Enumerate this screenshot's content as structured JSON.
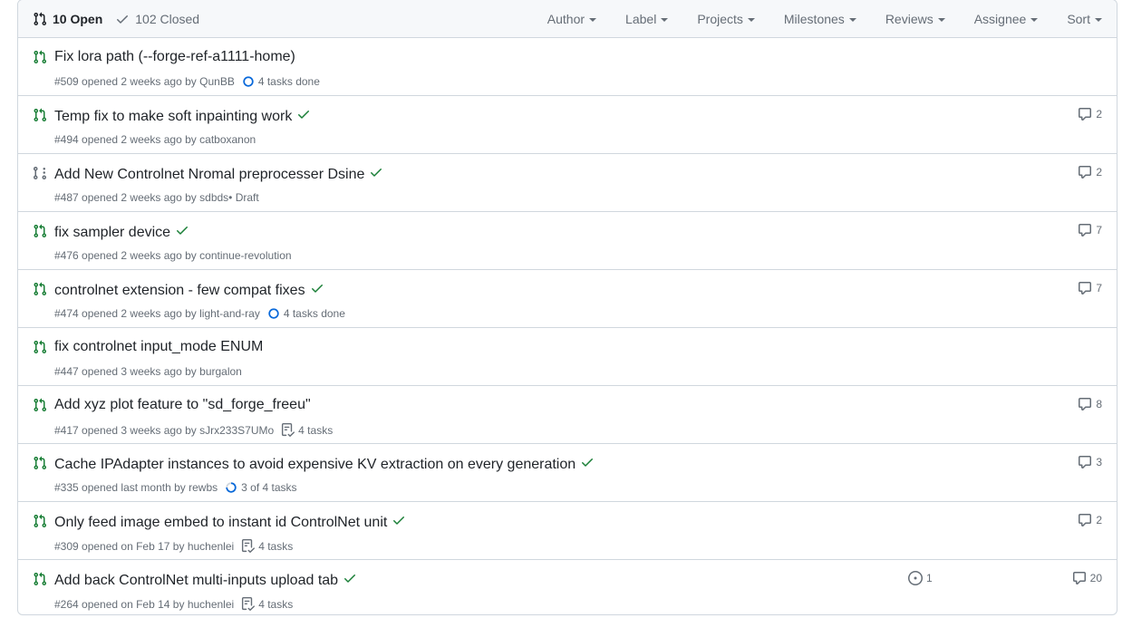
{
  "header": {
    "open_label": "10 Open",
    "closed_label": "102 Closed",
    "filters": [
      "Author",
      "Label",
      "Projects",
      "Milestones",
      "Reviews",
      "Assignee",
      "Sort"
    ]
  },
  "colors": {
    "open_green": "#1a7f37",
    "draft_gray": "#656d76",
    "task_blue": "#0969da",
    "border": "#d0d7de"
  },
  "pulls": [
    {
      "title": "Fix lora path (--forge-ref-a1111-home)",
      "meta": "#509 opened 2 weeks ago by",
      "author": "QunBB",
      "suffix": "",
      "status_check": false,
      "draft": false,
      "tasks": "4 tasks done",
      "tasks_icon": "circle",
      "comments": "",
      "linked": ""
    },
    {
      "title": "Temp fix to make soft inpainting work",
      "meta": "#494 opened 2 weeks ago by",
      "author": "catboxanon",
      "suffix": "",
      "status_check": true,
      "draft": false,
      "tasks": "",
      "tasks_icon": "",
      "comments": "2",
      "linked": ""
    },
    {
      "title": "Add New Controlnet Nromal preprocesser Dsine",
      "meta": "#487 opened 2 weeks ago by",
      "author": "sdbds",
      "suffix": " • Draft",
      "status_check": true,
      "draft": true,
      "tasks": "",
      "tasks_icon": "",
      "comments": "2",
      "linked": ""
    },
    {
      "title": "fix sampler device",
      "meta": "#476 opened 2 weeks ago by",
      "author": "continue-revolution",
      "suffix": "",
      "status_check": true,
      "draft": false,
      "tasks": "",
      "tasks_icon": "",
      "comments": "7",
      "linked": ""
    },
    {
      "title": "controlnet extension - few compat fixes",
      "meta": "#474 opened 2 weeks ago by",
      "author": "light-and-ray",
      "suffix": "",
      "status_check": true,
      "draft": false,
      "tasks": "4 tasks done",
      "tasks_icon": "circle",
      "comments": "7",
      "linked": ""
    },
    {
      "title": "fix controlnet input_mode ENUM",
      "meta": "#447 opened 3 weeks ago by",
      "author": "burgalon",
      "suffix": "",
      "status_check": false,
      "draft": false,
      "tasks": "",
      "tasks_icon": "",
      "comments": "",
      "linked": ""
    },
    {
      "title": "Add xyz plot feature to \"sd_forge_freeu\"",
      "meta": "#417 opened 3 weeks ago by",
      "author": "sJrx233S7UMo",
      "suffix": "",
      "status_check": false,
      "draft": false,
      "tasks": "4 tasks",
      "tasks_icon": "checklist",
      "comments": "8",
      "linked": ""
    },
    {
      "title": "Cache IPAdapter instances to avoid expensive KV extraction on every generation",
      "meta": "#335 opened last month by",
      "author": "rewbs",
      "suffix": "",
      "status_check": true,
      "draft": false,
      "tasks": "3 of 4 tasks",
      "tasks_icon": "progress",
      "comments": "3",
      "linked": ""
    },
    {
      "title": "Only feed image embed to instant id ControlNet unit",
      "meta": "#309 opened on Feb 17 by",
      "author": "huchenlei",
      "suffix": "",
      "status_check": true,
      "draft": false,
      "tasks": "4 tasks",
      "tasks_icon": "checklist",
      "comments": "2",
      "linked": ""
    },
    {
      "title": "Add back ControlNet multi-inputs upload tab",
      "meta": "#264 opened on Feb 14 by",
      "author": "huchenlei",
      "suffix": "",
      "status_check": true,
      "draft": false,
      "tasks": "4 tasks",
      "tasks_icon": "checklist",
      "comments": "20",
      "linked": "1"
    }
  ]
}
